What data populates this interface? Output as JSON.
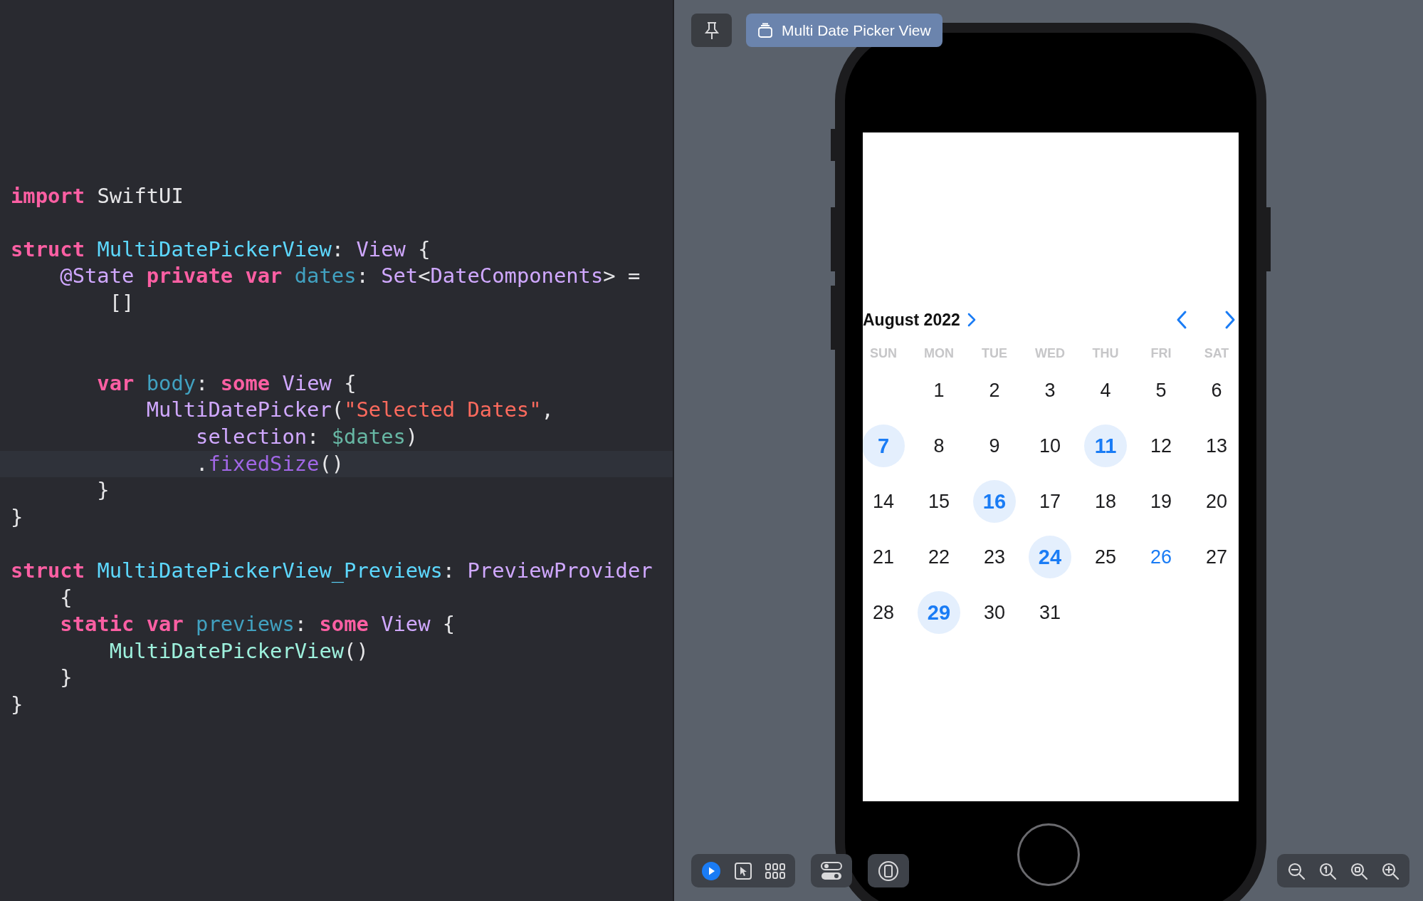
{
  "editor": {
    "lines": [
      {
        "kind": "blank"
      },
      {
        "kind": "code",
        "tokens": [
          {
            "text": "import ",
            "kind": "keyword"
          },
          {
            "text": "SwiftUI",
            "kind": "plain"
          }
        ]
      },
      {
        "kind": "blank"
      },
      {
        "kind": "code",
        "tokens": [
          {
            "text": "struct ",
            "kind": "keyword"
          },
          {
            "text": "MultiDatePickerView",
            "kind": "decl"
          },
          {
            "text": ": ",
            "kind": "plain"
          },
          {
            "text": "View",
            "kind": "type"
          },
          {
            "text": " {",
            "kind": "plain"
          }
        ]
      },
      {
        "kind": "code",
        "tokens": [
          {
            "text": "    @State ",
            "kind": "attr"
          },
          {
            "text": "private ",
            "kind": "keyword"
          },
          {
            "text": "var ",
            "kind": "keyword"
          },
          {
            "text": "dates",
            "kind": "prop"
          },
          {
            "text": ": ",
            "kind": "plain"
          },
          {
            "text": "Set",
            "kind": "type"
          },
          {
            "text": "<",
            "kind": "plain"
          },
          {
            "text": "DateComponents",
            "kind": "type"
          },
          {
            "text": "> =",
            "kind": "plain"
          }
        ]
      },
      {
        "kind": "code",
        "tokens": [
          {
            "text": "        []",
            "kind": "plain"
          }
        ]
      },
      {
        "kind": "blank"
      },
      {
        "kind": "blank"
      },
      {
        "kind": "code",
        "tokens": [
          {
            "text": "       var ",
            "kind": "keyword"
          },
          {
            "text": "body",
            "kind": "prop"
          },
          {
            "text": ": ",
            "kind": "plain"
          },
          {
            "text": "some ",
            "kind": "keyword"
          },
          {
            "text": "View",
            "kind": "type"
          },
          {
            "text": " {",
            "kind": "plain"
          }
        ]
      },
      {
        "kind": "code",
        "tokens": [
          {
            "text": "           MultiDatePicker",
            "kind": "type"
          },
          {
            "text": "(",
            "kind": "plain"
          },
          {
            "text": "\"Selected Dates\"",
            "kind": "string"
          },
          {
            "text": ",",
            "kind": "plain"
          }
        ]
      },
      {
        "kind": "code",
        "tokens": [
          {
            "text": "               selection",
            "kind": "type"
          },
          {
            "text": ": ",
            "kind": "plain"
          },
          {
            "text": "$dates",
            "kind": "projvar"
          },
          {
            "text": ")",
            "kind": "plain"
          }
        ]
      },
      {
        "kind": "current",
        "tokens": [
          {
            "text": "               .",
            "kind": "plain"
          },
          {
            "text": "fixedSize",
            "kind": "method"
          },
          {
            "text": "()",
            "kind": "plain"
          }
        ]
      },
      {
        "kind": "code",
        "tokens": [
          {
            "text": "       }",
            "kind": "plain"
          }
        ]
      },
      {
        "kind": "code",
        "tokens": [
          {
            "text": "}",
            "kind": "plain"
          }
        ]
      },
      {
        "kind": "blank"
      },
      {
        "kind": "code",
        "tokens": [
          {
            "text": "struct ",
            "kind": "keyword"
          },
          {
            "text": "MultiDatePickerView_Previews",
            "kind": "decl"
          },
          {
            "text": ": ",
            "kind": "plain"
          },
          {
            "text": "PreviewProvider",
            "kind": "type"
          }
        ]
      },
      {
        "kind": "code",
        "tokens": [
          {
            "text": "    {",
            "kind": "plain"
          }
        ]
      },
      {
        "kind": "code",
        "tokens": [
          {
            "text": "    static ",
            "kind": "keyword"
          },
          {
            "text": "var ",
            "kind": "keyword"
          },
          {
            "text": "previews",
            "kind": "prop"
          },
          {
            "text": ": ",
            "kind": "plain"
          },
          {
            "text": "some ",
            "kind": "keyword"
          },
          {
            "text": "View",
            "kind": "type"
          },
          {
            "text": " {",
            "kind": "plain"
          }
        ]
      },
      {
        "kind": "code",
        "tokens": [
          {
            "text": "        MultiDatePickerView",
            "kind": "projtype"
          },
          {
            "text": "()",
            "kind": "plain"
          }
        ]
      },
      {
        "kind": "code",
        "tokens": [
          {
            "text": "    }",
            "kind": "plain"
          }
        ]
      },
      {
        "kind": "code",
        "tokens": [
          {
            "text": "}",
            "kind": "plain"
          }
        ]
      }
    ]
  },
  "preview_tab": {
    "label": "Multi Date Picker View"
  },
  "calendar": {
    "month": "August 2022",
    "weekdays": [
      "SUN",
      "MON",
      "TUE",
      "WED",
      "THU",
      "FRI",
      "SAT"
    ],
    "days": [
      {
        "kind": "blank"
      },
      {
        "kind": "day",
        "label": "1",
        "selected": false,
        "today": false
      },
      {
        "kind": "day",
        "label": "2",
        "selected": false,
        "today": false
      },
      {
        "kind": "day",
        "label": "3",
        "selected": false,
        "today": false
      },
      {
        "kind": "day",
        "label": "4",
        "selected": false,
        "today": false
      },
      {
        "kind": "day",
        "label": "5",
        "selected": false,
        "today": false
      },
      {
        "kind": "day",
        "label": "6",
        "selected": false,
        "today": false
      },
      {
        "kind": "day",
        "label": "7",
        "selected": true,
        "today": false
      },
      {
        "kind": "day",
        "label": "8",
        "selected": false,
        "today": false
      },
      {
        "kind": "day",
        "label": "9",
        "selected": false,
        "today": false
      },
      {
        "kind": "day",
        "label": "10",
        "selected": false,
        "today": false
      },
      {
        "kind": "day",
        "label": "11",
        "selected": true,
        "today": false
      },
      {
        "kind": "day",
        "label": "12",
        "selected": false,
        "today": false
      },
      {
        "kind": "day",
        "label": "13",
        "selected": false,
        "today": false
      },
      {
        "kind": "day",
        "label": "14",
        "selected": false,
        "today": false
      },
      {
        "kind": "day",
        "label": "15",
        "selected": false,
        "today": false
      },
      {
        "kind": "day",
        "label": "16",
        "selected": true,
        "today": false
      },
      {
        "kind": "day",
        "label": "17",
        "selected": false,
        "today": false
      },
      {
        "kind": "day",
        "label": "18",
        "selected": false,
        "today": false
      },
      {
        "kind": "day",
        "label": "19",
        "selected": false,
        "today": false
      },
      {
        "kind": "day",
        "label": "20",
        "selected": false,
        "today": false
      },
      {
        "kind": "day",
        "label": "21",
        "selected": false,
        "today": false
      },
      {
        "kind": "day",
        "label": "22",
        "selected": false,
        "today": false
      },
      {
        "kind": "day",
        "label": "23",
        "selected": false,
        "today": false
      },
      {
        "kind": "day",
        "label": "24",
        "selected": true,
        "today": false
      },
      {
        "kind": "day",
        "label": "25",
        "selected": false,
        "today": false
      },
      {
        "kind": "day",
        "label": "26",
        "selected": false,
        "today": true
      },
      {
        "kind": "day",
        "label": "27",
        "selected": false,
        "today": false
      },
      {
        "kind": "day",
        "label": "28",
        "selected": false,
        "today": false
      },
      {
        "kind": "day",
        "label": "29",
        "selected": true,
        "today": false
      },
      {
        "kind": "day",
        "label": "30",
        "selected": false,
        "today": false
      },
      {
        "kind": "day",
        "label": "31",
        "selected": false,
        "today": false
      }
    ]
  }
}
